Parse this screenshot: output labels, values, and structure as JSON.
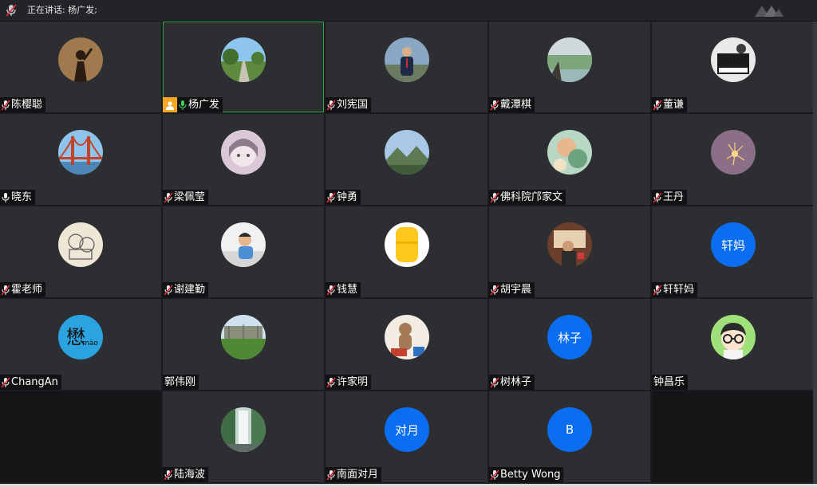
{
  "topbar": {
    "speaking_label": "正在讲话: 杨广发;"
  },
  "participants": [
    {
      "name": "陈樱聪",
      "mic": "muted",
      "avatar": "photo-silhouette"
    },
    {
      "name": "杨广发",
      "mic": "active",
      "avatar": "photo-road",
      "host": true,
      "active": true
    },
    {
      "name": "刘宪国",
      "mic": "muted",
      "avatar": "photo-man"
    },
    {
      "name": "戴潭棋",
      "mic": "muted",
      "avatar": "photo-lake"
    },
    {
      "name": "董谦",
      "mic": "muted",
      "avatar": "photo-piano"
    },
    {
      "name": "晓东",
      "mic": "on",
      "avatar": "photo-bridge"
    },
    {
      "name": " 梁佩莹",
      "mic": "muted",
      "avatar": "photo-anime"
    },
    {
      "name": "钟勇",
      "mic": "muted",
      "avatar": "photo-mountain"
    },
    {
      "name": "佛科院邝家文",
      "mic": "muted",
      "avatar": "photo-blur"
    },
    {
      "name": "王丹",
      "mic": "muted",
      "avatar": "photo-sparkler"
    },
    {
      "name": "霍老师",
      "mic": "muted",
      "avatar": "photo-cartoon"
    },
    {
      "name": "谢建勤",
      "mic": "muted",
      "avatar": "photo-kid"
    },
    {
      "name": "钱慧",
      "mic": "muted",
      "avatar": "photo-yellow"
    },
    {
      "name": "胡宇晨",
      "mic": "muted",
      "avatar": "photo-room"
    },
    {
      "name": "轩轩妈",
      "mic": "muted",
      "avatar": "text",
      "avatar_text": "轩妈"
    },
    {
      "name": "ChangAn",
      "mic": "muted",
      "avatar": "text-mao",
      "avatar_text": "懋",
      "avatar_subtext": "mào"
    },
    {
      "name": "郭伟刚",
      "mic": "none",
      "avatar": "photo-field"
    },
    {
      "name": "许家明",
      "mic": "muted",
      "avatar": "photo-toy"
    },
    {
      "name": "树林子",
      "mic": "muted",
      "avatar": "text",
      "avatar_text": "林子"
    },
    {
      "name": "钟昌乐",
      "mic": "none",
      "avatar": "photo-glasses"
    },
    {
      "name": "陆海波",
      "mic": "muted",
      "avatar": "photo-waterfall"
    },
    {
      "name": "南面对月",
      "mic": "muted",
      "avatar": "text",
      "avatar_text": "对月"
    },
    {
      "name": "Betty Wong",
      "mic": "muted",
      "avatar": "text",
      "avatar_text": "B"
    }
  ],
  "colors": {
    "tile_bg": "#2d2e31",
    "active_border": "#2ea84f",
    "avatar_blue": "#0b6df0",
    "host_orange": "#f5a623",
    "mic_muted_red": "#e0303a",
    "mic_on_green": "#3ccf5a"
  }
}
